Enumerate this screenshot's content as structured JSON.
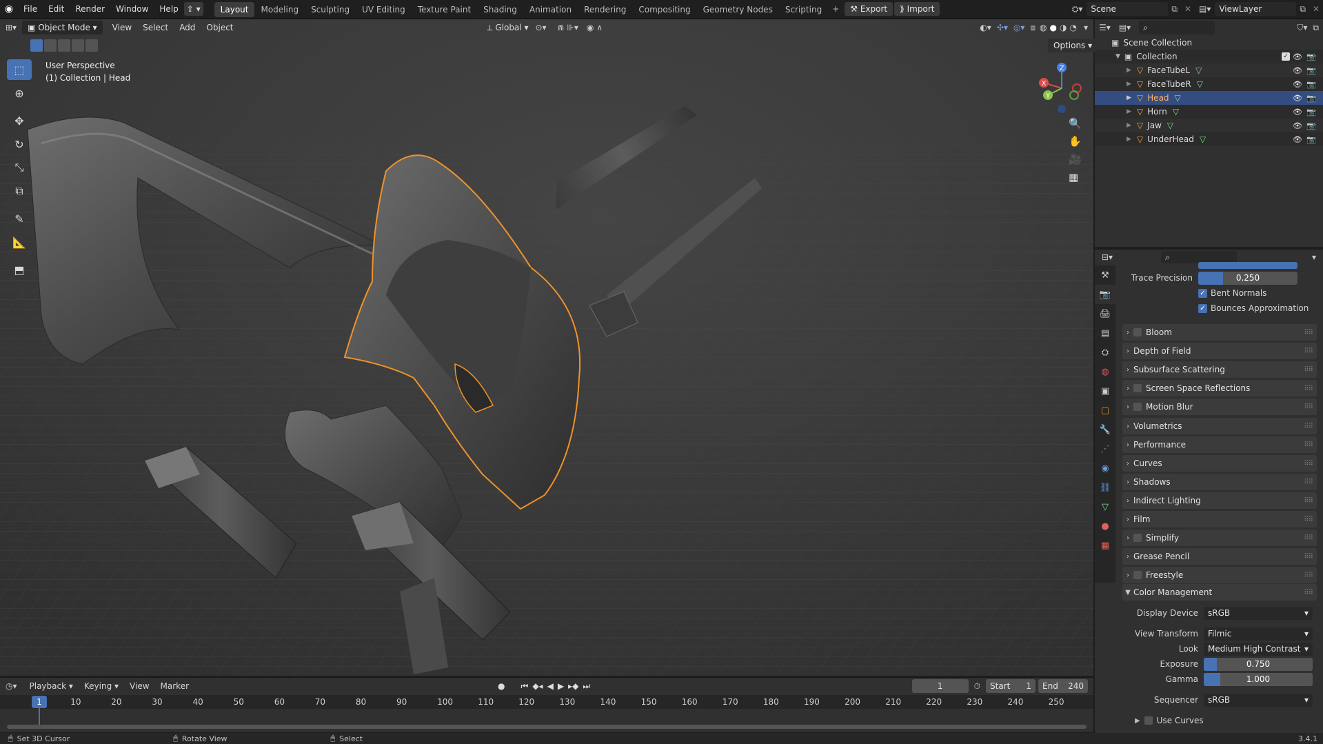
{
  "topbar": {
    "menus": [
      "File",
      "Edit",
      "Render",
      "Window",
      "Help"
    ],
    "workspaces": [
      "Layout",
      "Modeling",
      "Sculpting",
      "UV Editing",
      "Texture Paint",
      "Shading",
      "Animation",
      "Rendering",
      "Compositing",
      "Geometry Nodes",
      "Scripting"
    ],
    "active_workspace": "Layout",
    "export_label": "Export",
    "import_label": "Import",
    "scene_name": "Scene",
    "view_layer": "ViewLayer"
  },
  "viewport": {
    "mode": "Object Mode",
    "menus": [
      "View",
      "Select",
      "Add",
      "Object"
    ],
    "orientation": "Global",
    "options_label": "Options",
    "overlay_title": "User Perspective",
    "overlay_subtitle": "(1) Collection | Head",
    "gizmo_axes": [
      "X",
      "Y",
      "Z"
    ]
  },
  "outliner": {
    "root": "Scene Collection",
    "collection": "Collection",
    "objects": [
      "FaceTubeL",
      "FaceTubeR",
      "Head",
      "Horn",
      "Jaw",
      "UnderHead"
    ],
    "selected": "Head"
  },
  "properties": {
    "trace_precision_label": "Trace Precision",
    "trace_precision_value": "0.250",
    "trace_precision_fraction": 0.25,
    "bent_normals": "Bent Normals",
    "bounces_approx": "Bounces Approximation",
    "panels": [
      {
        "label": "Bloom",
        "checkbox": true
      },
      {
        "label": "Depth of Field",
        "checkbox": false
      },
      {
        "label": "Subsurface Scattering",
        "checkbox": false
      },
      {
        "label": "Screen Space Reflections",
        "checkbox": true
      },
      {
        "label": "Motion Blur",
        "checkbox": true
      },
      {
        "label": "Volumetrics",
        "checkbox": false
      },
      {
        "label": "Performance",
        "checkbox": false
      },
      {
        "label": "Curves",
        "checkbox": false
      },
      {
        "label": "Shadows",
        "checkbox": false
      },
      {
        "label": "Indirect Lighting",
        "checkbox": false
      },
      {
        "label": "Film",
        "checkbox": false
      },
      {
        "label": "Simplify",
        "checkbox": true
      },
      {
        "label": "Grease Pencil",
        "checkbox": false
      },
      {
        "label": "Freestyle",
        "checkbox": true
      }
    ],
    "color_management": {
      "title": "Color Management",
      "display_device_label": "Display Device",
      "display_device": "sRGB",
      "view_transform_label": "View Transform",
      "view_transform": "Filmic",
      "look_label": "Look",
      "look": "Medium High Contrast",
      "exposure_label": "Exposure",
      "exposure": "0.750",
      "exposure_fraction": 0.12,
      "gamma_label": "Gamma",
      "gamma": "1.000",
      "gamma_fraction": 0.15,
      "sequencer_label": "Sequencer",
      "sequencer": "sRGB",
      "use_curves": "Use Curves"
    }
  },
  "timeline": {
    "menus": [
      "Playback",
      "Keying",
      "View",
      "Marker"
    ],
    "current_frame": "1",
    "start_label": "Start",
    "start": "1",
    "end_label": "End",
    "end": "240",
    "ticks": [
      "1",
      "10",
      "20",
      "30",
      "40",
      "50",
      "60",
      "70",
      "80",
      "90",
      "100",
      "110",
      "120",
      "130",
      "140",
      "150",
      "160",
      "170",
      "180",
      "190",
      "200",
      "210",
      "220",
      "230",
      "240",
      "250"
    ]
  },
  "statusbar": {
    "items": [
      "Set 3D Cursor",
      "Rotate View",
      "Select"
    ],
    "version": "3.4.1"
  },
  "colors": {
    "accent": "#4772b3",
    "selection_outline": "#f0922a",
    "object_icon": "#ffa030",
    "mesh_icon": "#7ddf90"
  }
}
